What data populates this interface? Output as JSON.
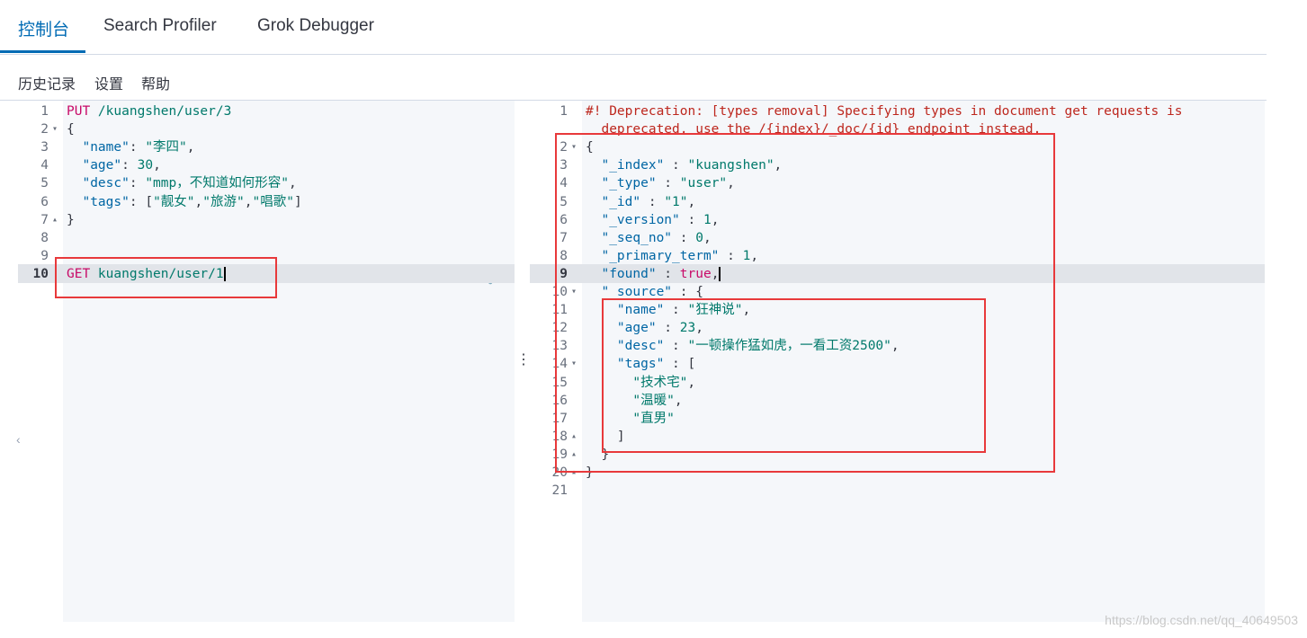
{
  "tabs": [
    {
      "label": "控制台",
      "active": true
    },
    {
      "label": "Search Profiler",
      "active": false
    },
    {
      "label": "Grok Debugger",
      "active": false
    }
  ],
  "subnav": [
    "历史记录",
    "设置",
    "帮助"
  ],
  "request_editor": {
    "lines": [
      {
        "n": "1",
        "fold": "",
        "parts": [
          [
            "method",
            "PUT"
          ],
          [
            "url",
            " /kuangshen/user/3"
          ]
        ]
      },
      {
        "n": "2",
        "fold": "▾",
        "parts": [
          [
            "punc",
            "{"
          ]
        ]
      },
      {
        "n": "3",
        "fold": "",
        "parts": [
          [
            "punc",
            "  "
          ],
          [
            "key",
            "\"name\""
          ],
          [
            "punc",
            ": "
          ],
          [
            "str",
            "\"李四\""
          ],
          [
            "punc",
            ","
          ]
        ]
      },
      {
        "n": "4",
        "fold": "",
        "parts": [
          [
            "punc",
            "  "
          ],
          [
            "key",
            "\"age\""
          ],
          [
            "punc",
            ": "
          ],
          [
            "num",
            "30"
          ],
          [
            "punc",
            ","
          ]
        ]
      },
      {
        "n": "5",
        "fold": "",
        "parts": [
          [
            "punc",
            "  "
          ],
          [
            "key",
            "\"desc\""
          ],
          [
            "punc",
            ": "
          ],
          [
            "str",
            "\"mmp，不知道如何形容\""
          ],
          [
            "punc",
            ","
          ]
        ]
      },
      {
        "n": "6",
        "fold": "",
        "parts": [
          [
            "punc",
            "  "
          ],
          [
            "key",
            "\"tags\""
          ],
          [
            "punc",
            ": ["
          ],
          [
            "str",
            "\"靓女\""
          ],
          [
            "punc",
            ","
          ],
          [
            "str",
            "\"旅游\""
          ],
          [
            "punc",
            ","
          ],
          [
            "str",
            "\"唱歌\""
          ],
          [
            "punc",
            "]"
          ]
        ]
      },
      {
        "n": "7",
        "fold": "▴",
        "parts": [
          [
            "punc",
            "}"
          ]
        ]
      },
      {
        "n": "8",
        "fold": "",
        "parts": []
      },
      {
        "n": "9",
        "fold": "",
        "parts": []
      },
      {
        "n": "10",
        "fold": "",
        "parts": [
          [
            "method",
            "GET"
          ],
          [
            "url",
            " kuangshen/user/1"
          ]
        ],
        "highlight": true
      }
    ],
    "actions": {
      "run": "▷",
      "wrench": "🔧"
    }
  },
  "response_editor": {
    "lines": [
      {
        "n": "1",
        "fold": "",
        "parts": [
          [
            "com",
            "#! Deprecation: [types removal] Specifying types in document get requests is"
          ]
        ]
      },
      {
        "n": "",
        "fold": "",
        "parts": [
          [
            "com",
            "  deprecated, use the /{index}/_doc/{id} endpoint instead."
          ]
        ]
      },
      {
        "n": "2",
        "fold": "▾",
        "parts": [
          [
            "punc",
            "{"
          ]
        ]
      },
      {
        "n": "3",
        "fold": "",
        "parts": [
          [
            "punc",
            "  "
          ],
          [
            "key",
            "\"_index\""
          ],
          [
            "punc",
            " : "
          ],
          [
            "str",
            "\"kuangshen\""
          ],
          [
            "punc",
            ","
          ]
        ]
      },
      {
        "n": "4",
        "fold": "",
        "parts": [
          [
            "punc",
            "  "
          ],
          [
            "key",
            "\"_type\""
          ],
          [
            "punc",
            " : "
          ],
          [
            "str",
            "\"user\""
          ],
          [
            "punc",
            ","
          ]
        ]
      },
      {
        "n": "5",
        "fold": "",
        "parts": [
          [
            "punc",
            "  "
          ],
          [
            "key",
            "\"_id\""
          ],
          [
            "punc",
            " : "
          ],
          [
            "str",
            "\"1\""
          ],
          [
            "punc",
            ","
          ]
        ]
      },
      {
        "n": "6",
        "fold": "",
        "parts": [
          [
            "punc",
            "  "
          ],
          [
            "key",
            "\"_version\""
          ],
          [
            "punc",
            " : "
          ],
          [
            "num",
            "1"
          ],
          [
            "punc",
            ","
          ]
        ]
      },
      {
        "n": "7",
        "fold": "",
        "parts": [
          [
            "punc",
            "  "
          ],
          [
            "key",
            "\"_seq_no\""
          ],
          [
            "punc",
            " : "
          ],
          [
            "num",
            "0"
          ],
          [
            "punc",
            ","
          ]
        ]
      },
      {
        "n": "8",
        "fold": "",
        "parts": [
          [
            "punc",
            "  "
          ],
          [
            "key",
            "\"_primary_term\""
          ],
          [
            "punc",
            " : "
          ],
          [
            "num",
            "1"
          ],
          [
            "punc",
            ","
          ]
        ]
      },
      {
        "n": "9",
        "fold": "",
        "parts": [
          [
            "punc",
            "  "
          ],
          [
            "key",
            "\"found\""
          ],
          [
            "punc",
            " : "
          ],
          [
            "bool",
            "true"
          ],
          [
            "punc",
            ","
          ]
        ],
        "highlight": true
      },
      {
        "n": "10",
        "fold": "▾",
        "parts": [
          [
            "punc",
            "  "
          ],
          [
            "key",
            "\"_source\""
          ],
          [
            "punc",
            " : {"
          ]
        ]
      },
      {
        "n": "11",
        "fold": "",
        "parts": [
          [
            "punc",
            "    "
          ],
          [
            "key",
            "\"name\""
          ],
          [
            "punc",
            " : "
          ],
          [
            "str",
            "\"狂神说\""
          ],
          [
            "punc",
            ","
          ]
        ]
      },
      {
        "n": "12",
        "fold": "",
        "parts": [
          [
            "punc",
            "    "
          ],
          [
            "key",
            "\"age\""
          ],
          [
            "punc",
            " : "
          ],
          [
            "num",
            "23"
          ],
          [
            "punc",
            ","
          ]
        ]
      },
      {
        "n": "13",
        "fold": "",
        "parts": [
          [
            "punc",
            "    "
          ],
          [
            "key",
            "\"desc\""
          ],
          [
            "punc",
            " : "
          ],
          [
            "str",
            "\"一顿操作猛如虎，一看工资2500\""
          ],
          [
            "punc",
            ","
          ]
        ]
      },
      {
        "n": "14",
        "fold": "▾",
        "parts": [
          [
            "punc",
            "    "
          ],
          [
            "key",
            "\"tags\""
          ],
          [
            "punc",
            " : ["
          ]
        ]
      },
      {
        "n": "15",
        "fold": "",
        "parts": [
          [
            "punc",
            "      "
          ],
          [
            "str",
            "\"技术宅\""
          ],
          [
            "punc",
            ","
          ]
        ]
      },
      {
        "n": "16",
        "fold": "",
        "parts": [
          [
            "punc",
            "      "
          ],
          [
            "str",
            "\"温暖\""
          ],
          [
            "punc",
            ","
          ]
        ]
      },
      {
        "n": "17",
        "fold": "",
        "parts": [
          [
            "punc",
            "      "
          ],
          [
            "str",
            "\"直男\""
          ]
        ]
      },
      {
        "n": "18",
        "fold": "▴",
        "parts": [
          [
            "punc",
            "    ]"
          ]
        ]
      },
      {
        "n": "19",
        "fold": "▴",
        "parts": [
          [
            "punc",
            "  }"
          ]
        ]
      },
      {
        "n": "20",
        "fold": "▴",
        "parts": [
          [
            "punc",
            "}"
          ]
        ]
      },
      {
        "n": "21",
        "fold": "",
        "parts": []
      }
    ]
  },
  "resizer": "⋮",
  "collapse": "‹",
  "watermark": "https://blog.csdn.net/qq_40649503",
  "colors": {
    "accent": "#006bb4",
    "annotation_red": "#e8393b",
    "method": "#c80a68",
    "string": "#00796b",
    "key": "#0066a4"
  }
}
